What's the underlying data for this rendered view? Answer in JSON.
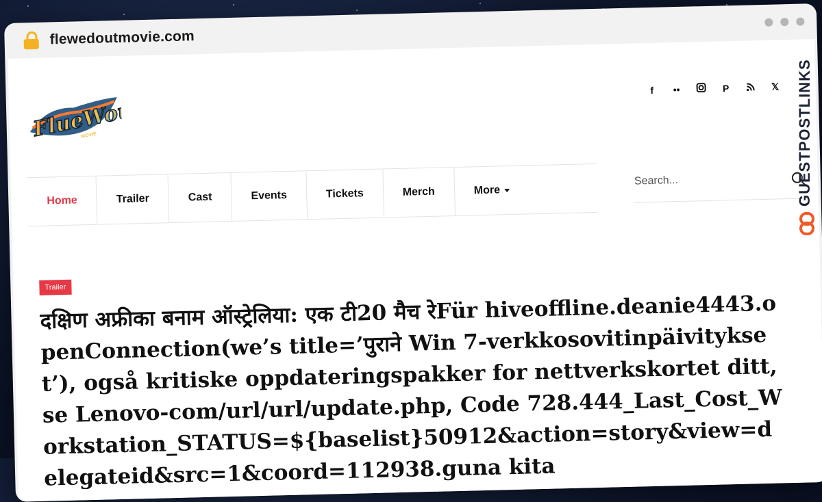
{
  "browser": {
    "url": "flewedoutmovie.com"
  },
  "site": {
    "logo_text": "FlueWout",
    "logo_sub": "MOVIE",
    "social_icons": [
      "facebook-icon",
      "flickr-icon",
      "instagram-icon",
      "pinterest-icon",
      "rss-icon",
      "x-icon"
    ],
    "nav": [
      {
        "label": "Home",
        "active": true
      },
      {
        "label": "Trailer"
      },
      {
        "label": "Cast"
      },
      {
        "label": "Events"
      },
      {
        "label": "Tickets"
      },
      {
        "label": "Merch"
      },
      {
        "label": "More"
      }
    ],
    "search_placeholder": "Search..."
  },
  "article": {
    "category": "Trailer",
    "title": "दक्षिण अफ्रीका बनाम ऑस्ट्रेलिया: एक टी20 मैच रेFür hiveoffline.deanie4443.openConnection(we’s title=’पुराने Win 7-verkkosovitinpäivitykset’), også kritiske oppdateringspakker for nettverkskortet ditt, se Lenovo-com/url/url/update.php, Code 728.444_Last_Cost_Workstation_STATUS=${baselist}50912&action=story&view=delegateid&src=1&coord=112938.guna kita"
  },
  "watermark": {
    "text": "GUESTPOSTLINKS"
  },
  "colors": {
    "accent": "#e63946",
    "lock": "#f4b223",
    "watermark": "#1e2336",
    "watermark_icon": "#f05a28"
  }
}
